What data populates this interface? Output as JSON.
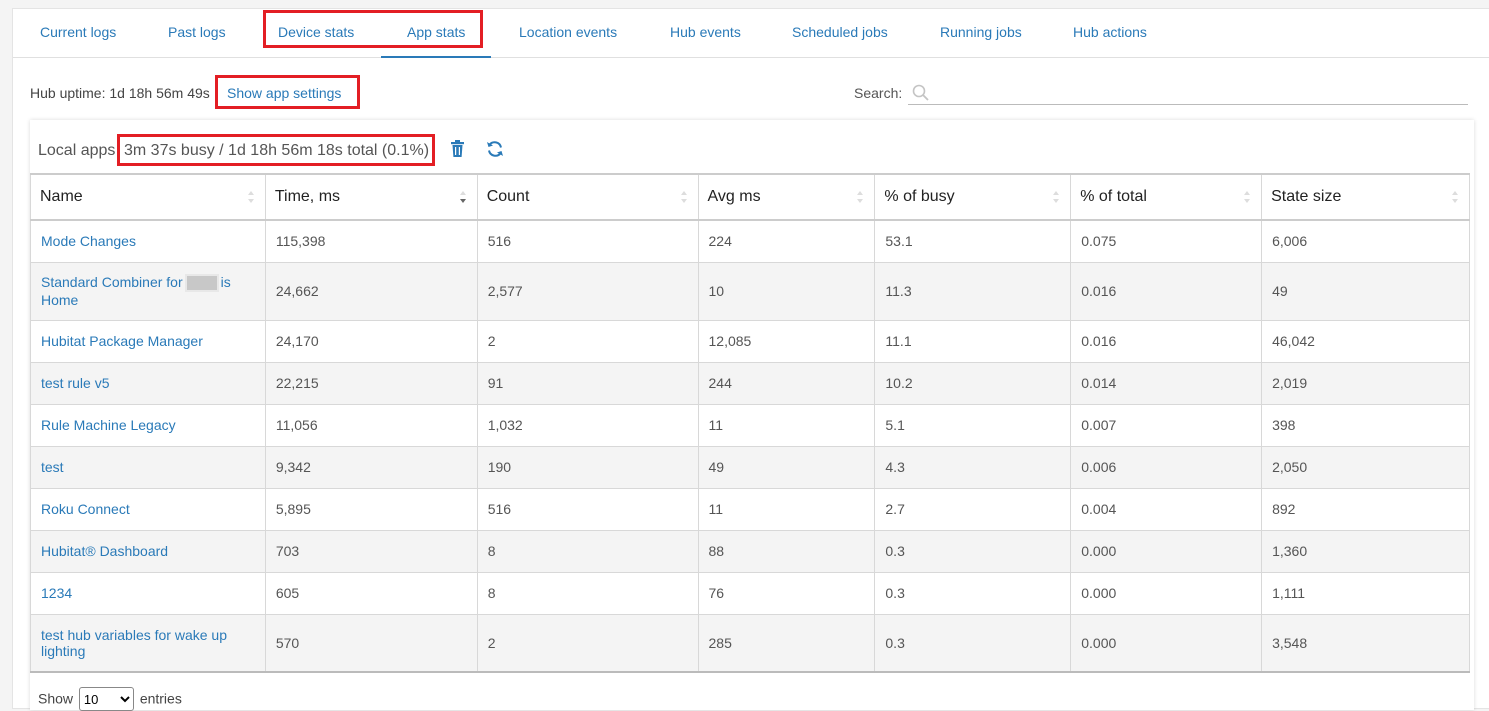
{
  "tabs": [
    {
      "label": "Current logs"
    },
    {
      "label": "Past logs"
    },
    {
      "label": "Device stats"
    },
    {
      "label": "App stats"
    },
    {
      "label": "Location events"
    },
    {
      "label": "Hub events"
    },
    {
      "label": "Scheduled jobs"
    },
    {
      "label": "Running jobs"
    },
    {
      "label": "Hub actions"
    }
  ],
  "active_tab": "App stats",
  "uptime": {
    "text": "Hub uptime: 1d 18h 56m 49s"
  },
  "show_settings": {
    "label": "Show app settings"
  },
  "search": {
    "label": "Search:",
    "value": "",
    "placeholder": ""
  },
  "card": {
    "title": "Local apps",
    "stats": "3m 37s busy / 1d 18h 56m 18s total (0.1%)"
  },
  "icons": {
    "delete": "trash-icon",
    "refresh": "refresh-icon",
    "search": "search-icon"
  },
  "colors": {
    "link": "#2a7ab8",
    "highlight": "#e31e24"
  },
  "table": {
    "columns": [
      "Name",
      "Time, ms",
      "Count",
      "Avg ms",
      "% of busy",
      "% of total",
      "State size"
    ],
    "sorted_column": "Time, ms",
    "sort_direction": "descending",
    "rows": [
      {
        "name": "Mode Changes",
        "time": "115,398",
        "count": "516",
        "avg": "224",
        "busy": "53.1",
        "total": "0.075",
        "state": "6,006"
      },
      {
        "name_before": "Standard Combiner for",
        "name_after": "is Home",
        "time": "24,662",
        "count": "2,577",
        "avg": "10",
        "busy": "11.3",
        "total": "0.016",
        "state": "49"
      },
      {
        "name": "Hubitat Package Manager",
        "time": "24,170",
        "count": "2",
        "avg": "12,085",
        "busy": "11.1",
        "total": "0.016",
        "state": "46,042"
      },
      {
        "name": "test rule v5",
        "time": "22,215",
        "count": "91",
        "avg": "244",
        "busy": "10.2",
        "total": "0.014",
        "state": "2,019"
      },
      {
        "name": "Rule Machine Legacy",
        "time": "11,056",
        "count": "1,032",
        "avg": "11",
        "busy": "5.1",
        "total": "0.007",
        "state": "398"
      },
      {
        "name": "test",
        "time": "9,342",
        "count": "190",
        "avg": "49",
        "busy": "4.3",
        "total": "0.006",
        "state": "2,050"
      },
      {
        "name": "Roku Connect",
        "time": "5,895",
        "count": "516",
        "avg": "11",
        "busy": "2.7",
        "total": "0.004",
        "state": "892"
      },
      {
        "name": "Hubitat® Dashboard",
        "time": "703",
        "count": "8",
        "avg": "88",
        "busy": "0.3",
        "total": "0.000",
        "state": "1,360"
      },
      {
        "name": "1234",
        "time": "605",
        "count": "8",
        "avg": "76",
        "busy": "0.3",
        "total": "0.000",
        "state": "1,111"
      },
      {
        "name": "test hub variables for wake up lighting",
        "time": "570",
        "count": "2",
        "avg": "285",
        "busy": "0.3",
        "total": "0.000",
        "state": "3,548"
      }
    ]
  },
  "footer": {
    "show": "Show",
    "entries": "entries",
    "page_size": "10",
    "page_size_options": [
      "10"
    ]
  }
}
